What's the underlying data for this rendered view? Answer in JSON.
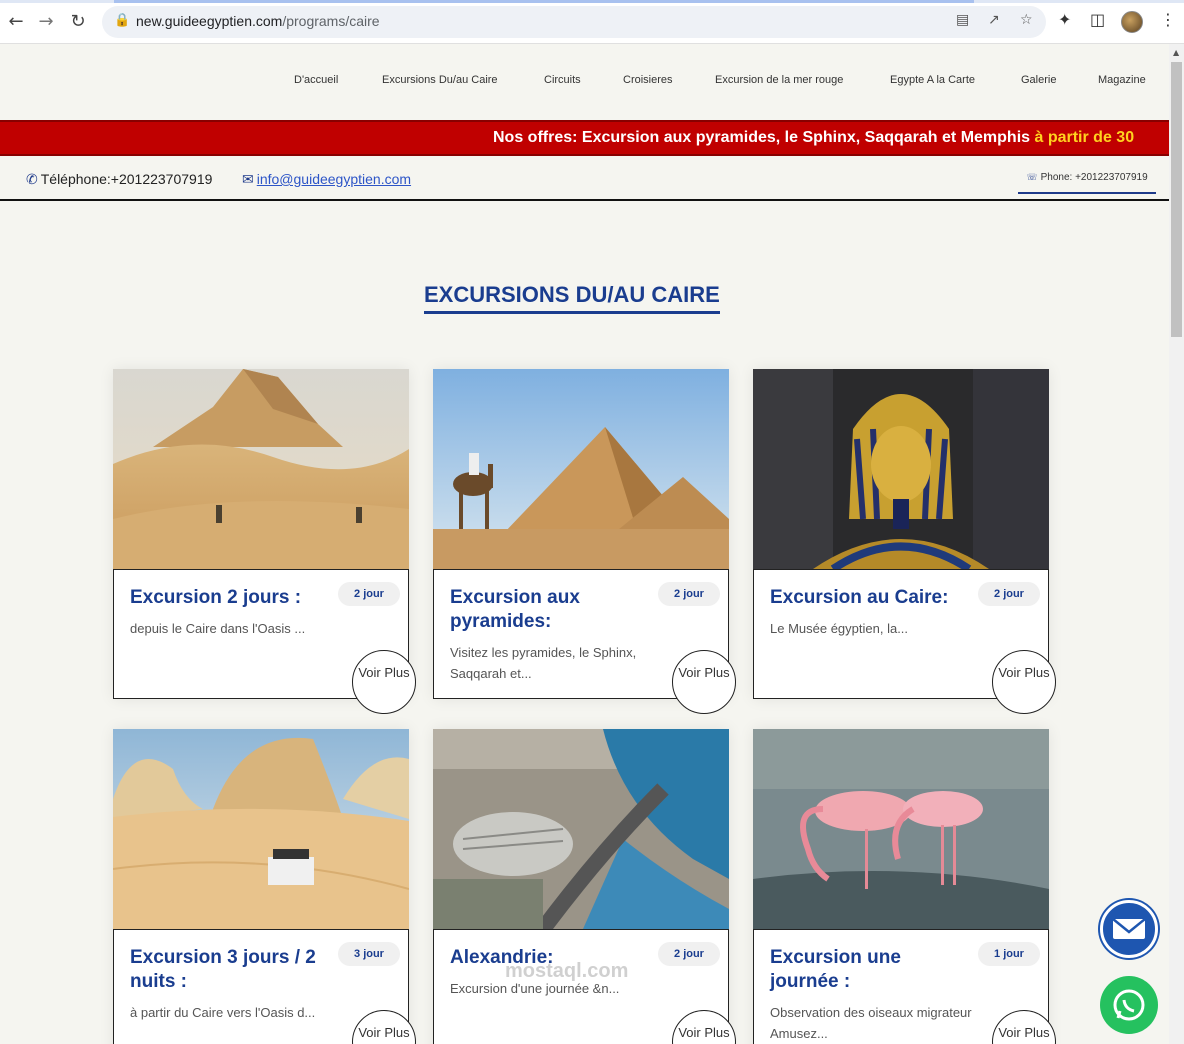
{
  "browser": {
    "url_host": "new.guideegyptien.com",
    "url_path": "/programs/caire"
  },
  "nav": {
    "items": [
      "D'accueil",
      "Excursions Du/au Caire",
      "Circuits",
      "Croisieres",
      "Excursion de la mer rouge",
      "Egypte A la Carte",
      "Galerie",
      "Magazine"
    ]
  },
  "ticker": {
    "text": "Nos offres: Excursion aux pyramides, le Sphinx, Saqqarah et Memphis ",
    "highlight": "à partir de 30"
  },
  "contact": {
    "phone": "Téléphone:+201223707919",
    "email": "info@guideegyptien.com",
    "whatsapp": "Phone: +201223707919"
  },
  "section": {
    "title": "EXCURSIONS DU/AU CAIRE"
  },
  "cards": [
    {
      "title": "Excursion 2 jours :",
      "desc": "depuis le Caire dans l'Oasis ...",
      "badge": "2 jour",
      "more": "Voir Plus"
    },
    {
      "title": "Excursion aux pyramides:",
      "desc": "Visitez les pyramides, le Sphinx, Saqqarah et...",
      "badge": "2 jour",
      "more": "Voir Plus"
    },
    {
      "title": "Excursion au Caire:",
      "desc": "Le Musée égyptien, la...",
      "badge": "2 jour",
      "more": "Voir Plus"
    },
    {
      "title": "Excursion 3 jours / 2 nuits :",
      "desc": "à partir du Caire vers l'Oasis d...",
      "badge": "3 jour",
      "more": "Voir Plus"
    },
    {
      "title": "Alexandrie:",
      "desc": "Excursion d'une journée &n...",
      "badge": "2 jour",
      "more": "Voir Plus"
    },
    {
      "title": "Excursion une journée :",
      "desc": "Observation des oiseaux migrateur Amusez...",
      "badge": "1 jour",
      "more": "Voir Plus"
    }
  ],
  "watermark": "mostaql.com",
  "colors": {
    "brand_blue": "#1a3d8f",
    "ticker_red": "#c00000",
    "highlight_yellow": "#ffd21f",
    "whatsapp_green": "#25c15f"
  }
}
